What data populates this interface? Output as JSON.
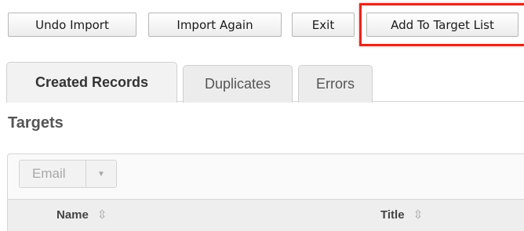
{
  "toolbar": {
    "undo_label": "Undo Import",
    "import_again_label": "Import Again",
    "exit_label": "Exit",
    "add_to_target_label": "Add To Target List"
  },
  "tabs": [
    {
      "label": "Created Records",
      "active": true
    },
    {
      "label": "Duplicates",
      "active": false
    },
    {
      "label": "Errors",
      "active": false
    }
  ],
  "section_title": "Targets",
  "list": {
    "action_button_label": "Email",
    "caret_icon": "caret-down-icon",
    "columns": [
      {
        "label": "Name",
        "sort_icon": "sort-icon"
      },
      {
        "label": "Title",
        "sort_icon": "sort-icon"
      }
    ]
  },
  "colors": {
    "highlight": "#e8251b",
    "button_border": "#b7b7b7",
    "tab_active": "#f2f2f2",
    "tab_inactive": "#ececec"
  }
}
